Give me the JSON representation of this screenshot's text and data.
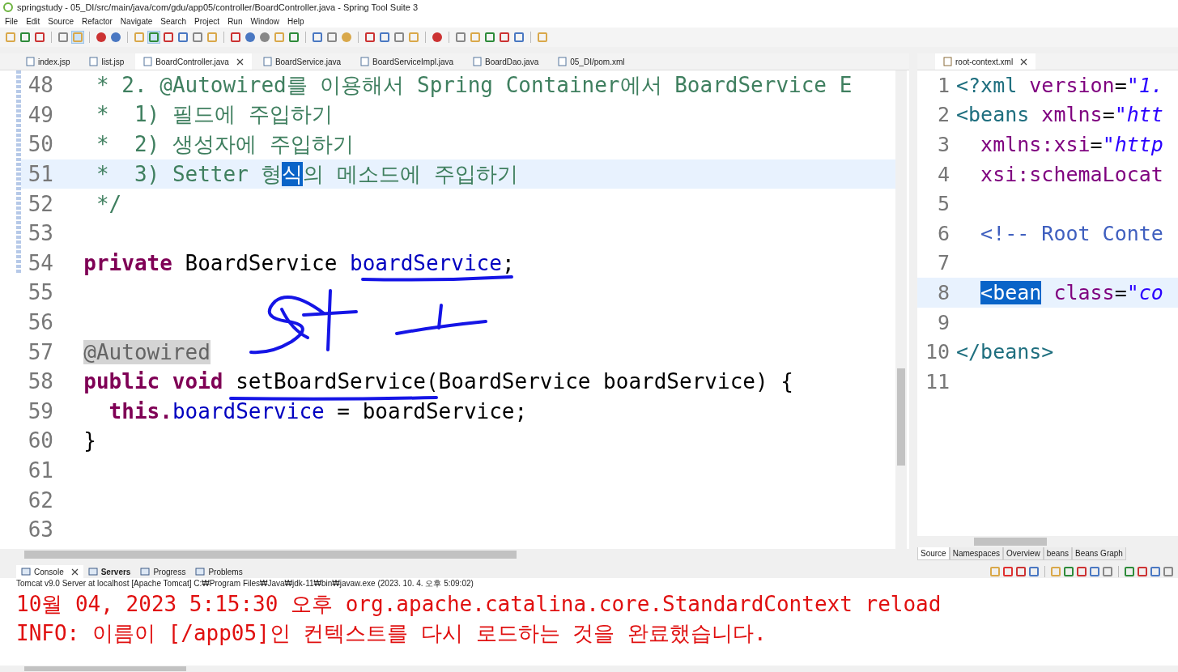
{
  "window": {
    "title": "springstudy - 05_DI/src/main/java/com/gdu/app05/controller/BoardController.java - Spring Tool Suite 3"
  },
  "menu": [
    "File",
    "Edit",
    "Source",
    "Refactor",
    "Navigate",
    "Search",
    "Project",
    "Run",
    "Window",
    "Help"
  ],
  "editor": {
    "tabs": [
      {
        "label": "index.jsp",
        "selected": false
      },
      {
        "label": "list.jsp",
        "selected": false
      },
      {
        "label": "BoardController.java",
        "selected": true
      },
      {
        "label": "BoardService.java",
        "selected": false
      },
      {
        "label": "BoardServiceImpl.java",
        "selected": false
      },
      {
        "label": "BoardDao.java",
        "selected": false
      },
      {
        "label": "05_DI/pom.xml",
        "selected": false
      }
    ],
    "lines": [
      {
        "number": "48",
        "current": false,
        "tokens": [
          {
            "kind": "comment",
            "text": "   * 2. @Autowired를 이용해서 Spring Container에서 BoardService E"
          }
        ]
      },
      {
        "number": "49",
        "current": false,
        "tokens": [
          {
            "kind": "comment",
            "text": "   *  1) 필드에 주입하기"
          }
        ]
      },
      {
        "number": "50",
        "current": false,
        "tokens": [
          {
            "kind": "comment",
            "text": "   *  2) 생성자에 주입하기"
          }
        ]
      },
      {
        "number": "51",
        "current": true,
        "tokens": [
          {
            "kind": "comment",
            "text": "   *  3) Setter 형"
          },
          {
            "kind": "selection",
            "text": "식"
          },
          {
            "kind": "comment",
            "text": "의 메소드에 주입하기"
          }
        ]
      },
      {
        "number": "52",
        "current": false,
        "tokens": [
          {
            "kind": "comment",
            "text": "   */"
          }
        ]
      },
      {
        "number": "53",
        "current": false
      },
      {
        "number": "54",
        "current": false,
        "tokens": [
          {
            "kind": "indent"
          },
          {
            "kind": "keyword",
            "text": "private"
          },
          {
            "kind": "plain",
            "text": " BoardService "
          },
          {
            "kind": "field",
            "text": "boardService"
          },
          {
            "kind": "plain",
            "text": ";"
          }
        ]
      },
      {
        "number": "55",
        "current": false
      },
      {
        "number": "56",
        "current": false
      },
      {
        "number": "57",
        "current": false,
        "tokens": [
          {
            "kind": "indent"
          },
          {
            "kind": "marked",
            "text": "@Autowired"
          }
        ]
      },
      {
        "number": "58",
        "current": false,
        "tokens": [
          {
            "kind": "indent"
          },
          {
            "kind": "keyword",
            "text": "public"
          },
          {
            "kind": "keyword",
            "text": " void"
          },
          {
            "kind": "plain",
            "text": " setBoardService(BoardService boardService) {"
          }
        ]
      },
      {
        "number": "59",
        "current": false,
        "tokens": [
          {
            "kind": "indent"
          },
          {
            "kind": "indent"
          },
          {
            "kind": "keyword",
            "text": "this."
          },
          {
            "kind": "field",
            "text": "boardService"
          },
          {
            "kind": "plain",
            "text": " = boardService;"
          }
        ]
      },
      {
        "number": "60",
        "current": false,
        "tokens": [
          {
            "kind": "plain",
            "text": "  }"
          }
        ]
      },
      {
        "number": "61",
        "current": false
      },
      {
        "number": "62",
        "current": false
      },
      {
        "number": "63",
        "current": false
      }
    ]
  },
  "xml_editor": {
    "tabs": [
      {
        "label": "root-context.xml",
        "selected": true
      }
    ],
    "lines": [
      {
        "number": "1",
        "current": false,
        "tokens": [
          {
            "kind": "tag",
            "text": "<?xml"
          },
          {
            "kind": "attr",
            "text": " version"
          },
          {
            "kind": "plain",
            "text": "="
          },
          {
            "kind": "string",
            "text": "\"1."
          }
        ]
      },
      {
        "number": "2",
        "current": false,
        "tokens": [
          {
            "kind": "tag",
            "text": "<beans"
          },
          {
            "kind": "attr",
            "text": " xmlns"
          },
          {
            "kind": "plain",
            "text": "="
          },
          {
            "kind": "string",
            "text": "\"htt"
          }
        ]
      },
      {
        "number": "3",
        "current": false,
        "tokens": [
          {
            "kind": "indent"
          },
          {
            "kind": "attr",
            "text": "xmlns:xsi"
          },
          {
            "kind": "plain",
            "text": "="
          },
          {
            "kind": "string",
            "text": "\"http"
          }
        ]
      },
      {
        "number": "4",
        "current": false,
        "tokens": [
          {
            "kind": "indent"
          },
          {
            "kind": "attr",
            "text": "xsi:schemaLocat"
          }
        ]
      },
      {
        "number": "5",
        "current": false
      },
      {
        "number": "6",
        "current": false,
        "tokens": [
          {
            "kind": "indent"
          },
          {
            "kind": "xcomment",
            "text": "<!-- Root Conte"
          }
        ]
      },
      {
        "number": "7",
        "current": false
      },
      {
        "number": "8",
        "current": true,
        "tokens": [
          {
            "kind": "indent"
          },
          {
            "kind": "selection",
            "text": "<bean"
          },
          {
            "kind": "attr",
            "text": " class"
          },
          {
            "kind": "plain",
            "text": "="
          },
          {
            "kind": "string",
            "text": "\"co"
          }
        ]
      },
      {
        "number": "9",
        "current": false
      },
      {
        "number": "10",
        "current": false,
        "tokens": [
          {
            "kind": "tag",
            "text": "</beans>"
          }
        ]
      },
      {
        "number": "11",
        "current": false
      }
    ],
    "bottom_tabs": [
      {
        "label": "Source",
        "selected": true
      },
      {
        "label": "Namespaces",
        "selected": false
      },
      {
        "label": "Overview",
        "selected": false
      },
      {
        "label": "beans",
        "selected": false
      },
      {
        "label": "Beans Graph",
        "selected": false
      }
    ]
  },
  "console": {
    "tabs": [
      {
        "label": "Console",
        "selected": true,
        "bold": false
      },
      {
        "label": "Servers",
        "selected": false,
        "bold": true
      },
      {
        "label": "Progress",
        "selected": false,
        "bold": false
      },
      {
        "label": "Problems",
        "selected": false,
        "bold": false
      }
    ],
    "process": "Tomcat v9.0 Server at localhost [Apache Tomcat] C:₩Program Files₩Java₩jdk-11₩bin₩javaw.exe  (2023. 10. 4. 오후 5:09:02)",
    "lines": [
      "10월 04, 2023 5:15:30 오후 org.apache.catalina.core.StandardContext reload",
      "INFO: 이름이 [/app05]인 컨텍스트를 다시 로드하는 것을 완료했습니다."
    ]
  }
}
